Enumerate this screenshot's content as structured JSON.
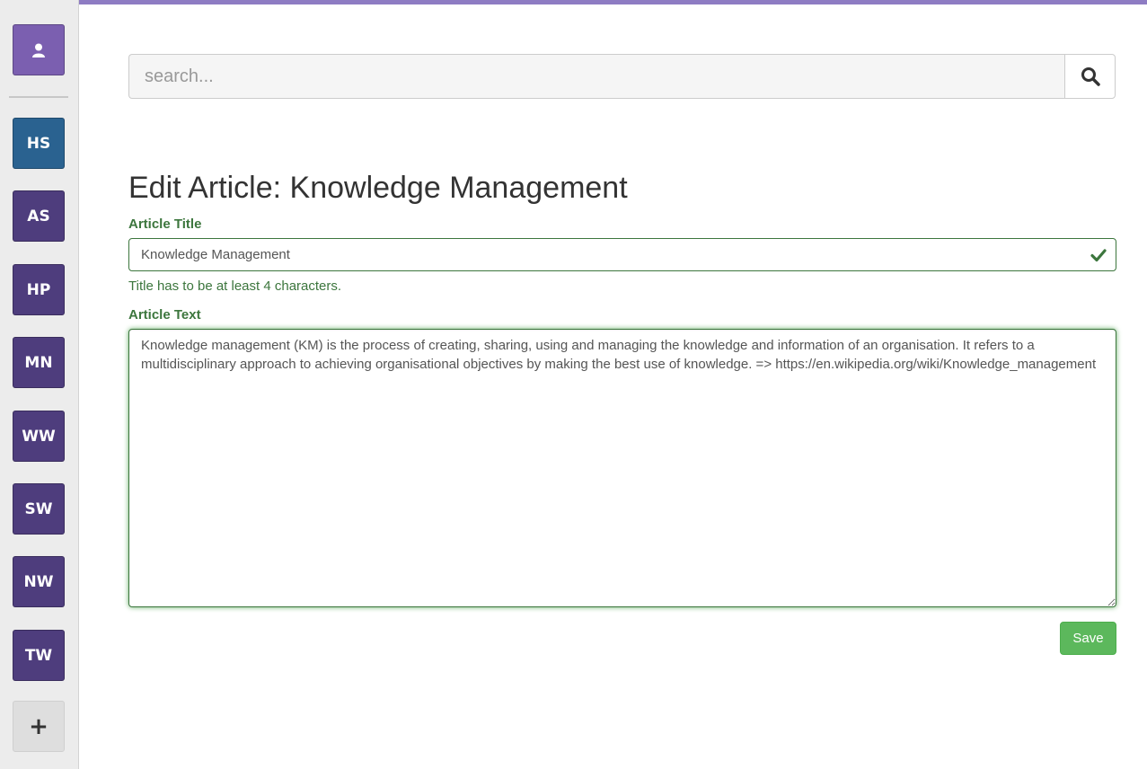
{
  "sidebar": {
    "user_icon": "user-icon",
    "items": [
      {
        "label": "HS"
      },
      {
        "label": "AS"
      },
      {
        "label": "HP"
      },
      {
        "label": "MN"
      },
      {
        "label": "WW"
      },
      {
        "label": "SW"
      },
      {
        "label": "NW"
      },
      {
        "label": "TW"
      }
    ],
    "add_label": "+"
  },
  "search": {
    "placeholder": "search...",
    "icon": "search-icon"
  },
  "page": {
    "title": "Edit Article: Knowledge Management"
  },
  "form": {
    "title_label": "Article Title",
    "title_value": "Knowledge Management",
    "title_help": "Title has to be at least 4 characters.",
    "text_label": "Article Text",
    "text_value": "Knowledge management (KM) is the process of creating, sharing, using and managing the knowledge and information of an organisation. It refers to a multidisciplinary approach to achieving organisational objectives by making the best use of knowledge. => https://en.wikipedia.org/wiki/Knowledge_management",
    "save_label": "Save"
  },
  "colors": {
    "accent": "#8e7cc3",
    "success": "#3c763d",
    "save": "#5cb85c",
    "sidebar_button": "#4e3d7d",
    "sidebar_active": "#2a6290"
  }
}
